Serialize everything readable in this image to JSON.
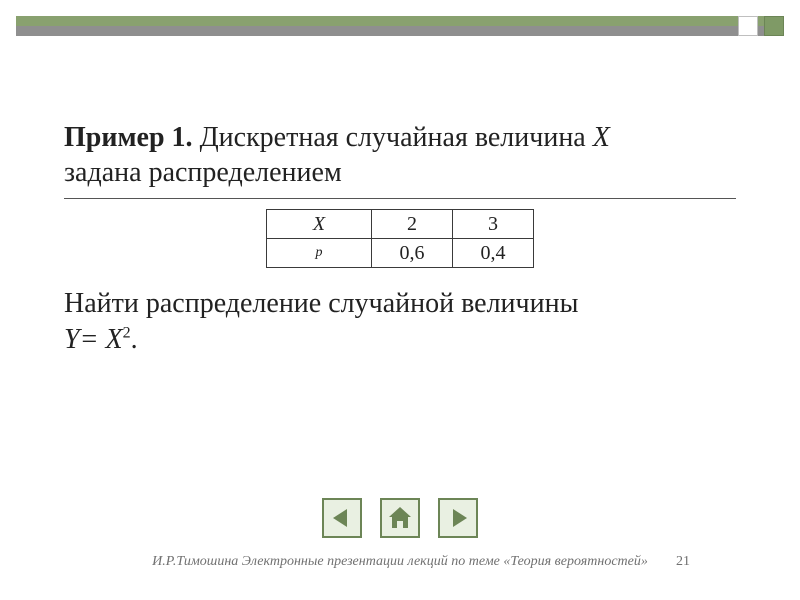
{
  "heading": {
    "bold": "Пример 1.",
    "rest_line1": " Дискретная случайная величина ",
    "rv": "X",
    "rest_line2": "задана распределением"
  },
  "table": {
    "row_labels": [
      "X",
      "p"
    ],
    "data": [
      [
        "2",
        "3"
      ],
      [
        "0,6",
        "0,4"
      ]
    ]
  },
  "task": {
    "line1": "Найти распределение случайной величины",
    "eq_left": "Y= X",
    "eq_sup": "2",
    "eq_end": "."
  },
  "footer": "И.Р.Тимошина Электронные презентации лекций по теме «Теория вероятностей»",
  "page_number": "21",
  "colors": {
    "accent_green": "#89a16f",
    "accent_gray": "#8f8f8f"
  }
}
